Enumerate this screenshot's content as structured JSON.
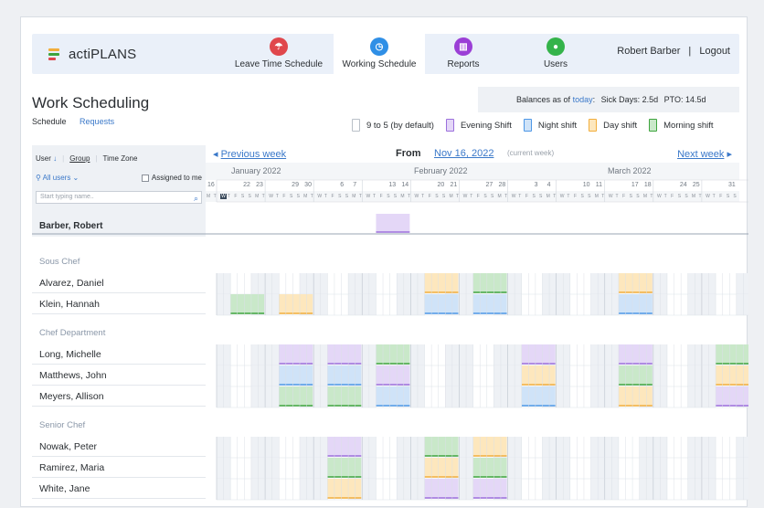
{
  "app": {
    "name": "actiPLANS"
  },
  "nav": {
    "tabs": [
      {
        "label": "Leave Time Schedule",
        "icon": "umbrella-icon",
        "color": "#e0474c"
      },
      {
        "label": "Working Schedule",
        "icon": "clock-icon",
        "color": "#2f8fe6"
      },
      {
        "label": "Reports",
        "icon": "chart-icon",
        "color": "#9b3fd6"
      },
      {
        "label": "Users",
        "icon": "user-icon",
        "color": "#34b34a"
      }
    ],
    "user": "Robert Barber",
    "separator": "|",
    "logout": "Logout"
  },
  "page": {
    "title": "Work Scheduling",
    "subtabs": [
      "Schedule",
      "Requests"
    ],
    "balances_prefix": "Balances as of",
    "balances_link": "today",
    "balances_colon": ":",
    "sick_days": "Sick Days: 2.5d",
    "pto": "PTO: 14.5d"
  },
  "legend": [
    {
      "label": "9 to 5 (by default)",
      "key": "default",
      "color": "#ffffff",
      "border": "#b9c0c8"
    },
    {
      "label": "Evening Shift",
      "key": "evening",
      "color": "#e4d7f7",
      "border": "#9b6fdc"
    },
    {
      "label": "Night shift",
      "key": "night",
      "color": "#cfe3f8",
      "border": "#4d97e6"
    },
    {
      "label": "Day shift",
      "key": "day",
      "color": "#fde7bd",
      "border": "#f2ae3c"
    },
    {
      "label": "Morning shift",
      "key": "morning",
      "color": "#c9e8c9",
      "border": "#3ea43e"
    }
  ],
  "filters": {
    "user": "User",
    "sort_arrow": "↓",
    "group": "Group",
    "timezone": "Time Zone",
    "all_users": "All users",
    "assigned": "Assigned to me",
    "search_placeholder": "Start typing name.."
  },
  "weeknav": {
    "prev": "Previous week",
    "from": "From",
    "date": "Nov 16, 2022",
    "current": "(current week)",
    "next": "Next week"
  },
  "months": [
    "January 2022",
    "February 2022",
    "March 2022"
  ],
  "day_numbers": [
    "16",
    "22",
    "23",
    "29",
    "30",
    "6",
    "7",
    "13",
    "14",
    "20",
    "21",
    "27",
    "28",
    "3",
    "4",
    "10",
    "11",
    "17",
    "18",
    "24",
    "25",
    "31"
  ],
  "day_letters": [
    "M",
    "T",
    "W",
    "T",
    "F",
    "S",
    "S"
  ],
  "current_user": "Barber, Robert",
  "groups": [
    {
      "name": "Sous Chef",
      "members": [
        "Alvarez, Daniel",
        "Klein, Hannah"
      ]
    },
    {
      "name": "Chef Department",
      "members": [
        "Long, Michelle",
        "Matthews, John",
        "Meyers, Allison"
      ]
    },
    {
      "name": "Senior Chef",
      "members": [
        "Nowak, Peter",
        "Ramirez, Maria",
        "White, Jane"
      ]
    }
  ],
  "schedule": {
    "Barber, Robert": {
      "3": "evening"
    },
    "Alvarez, Daniel": {
      "4": "day",
      "5": "morning",
      "8": "day"
    },
    "Klein, Hannah": {
      "0": "morning",
      "1": "day",
      "4": "night",
      "5": "night",
      "8": "night"
    },
    "Long, Michelle": {
      "1": "evening",
      "2": "evening",
      "3": "morning",
      "6": "evening",
      "8": "evening",
      "10": "morning"
    },
    "Matthews, John": {
      "1": "night",
      "2": "night",
      "3": "evening",
      "6": "day",
      "8": "morning",
      "10": "day"
    },
    "Meyers, Allison": {
      "1": "morning",
      "2": "morning",
      "3": "night",
      "6": "night",
      "8": "day",
      "10": "evening"
    },
    "Nowak, Peter": {
      "2": "evening",
      "4": "morning",
      "5": "day"
    },
    "Ramirez, Maria": {
      "2": "morning",
      "4": "day",
      "5": "morning"
    },
    "White, Jane": {
      "2": "day",
      "4": "evening",
      "5": "evening"
    }
  }
}
